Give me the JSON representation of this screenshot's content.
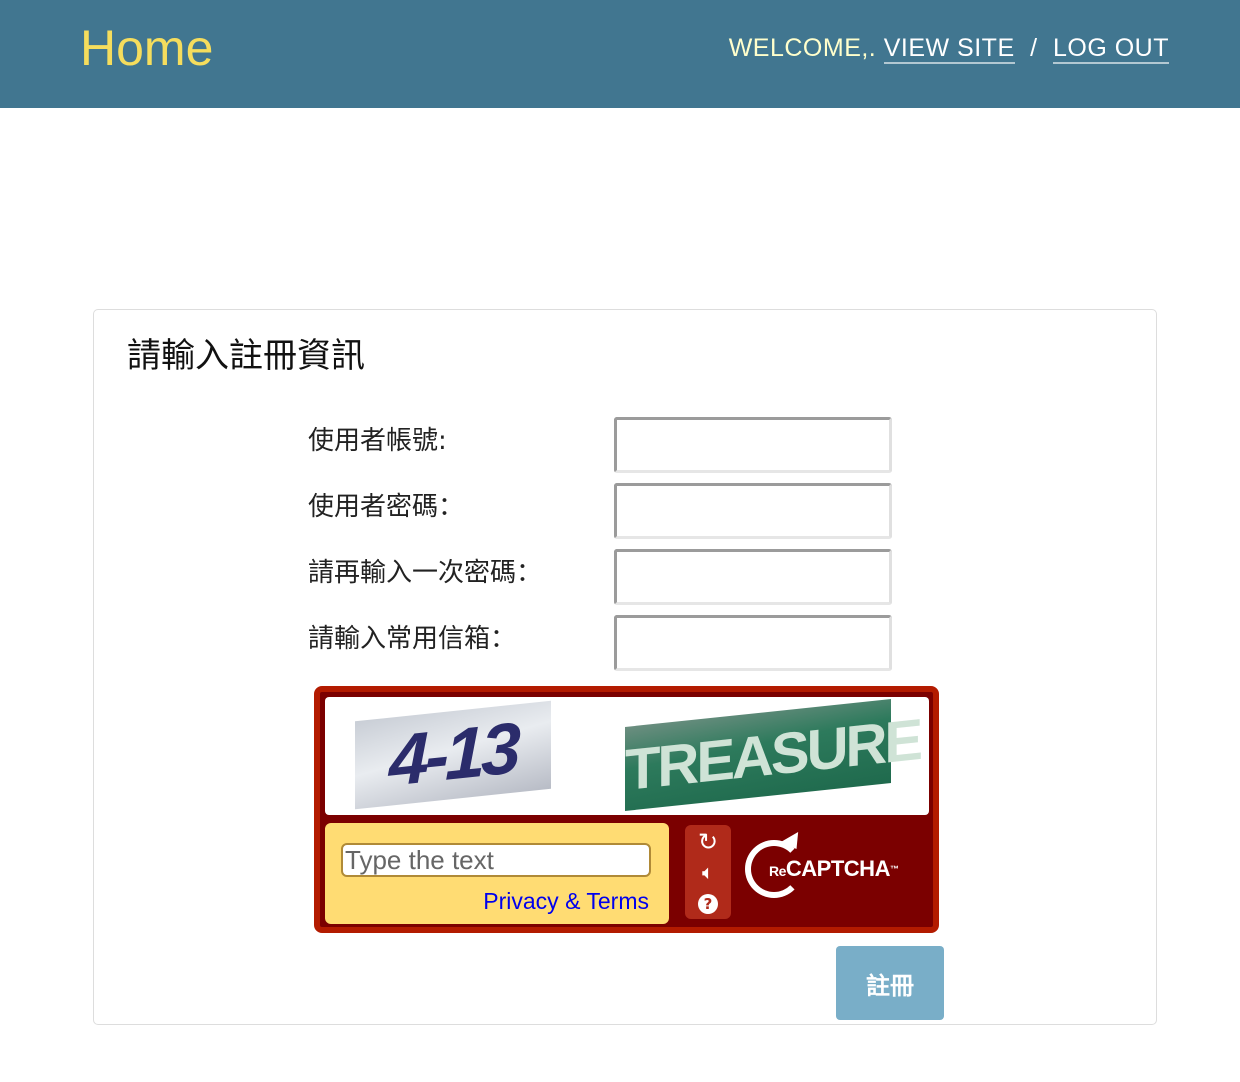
{
  "header": {
    "brand": "Home",
    "welcome_text": "WELCOME,.",
    "view_site": "VIEW SITE",
    "separator": "/",
    "log_out": "LOG OUT"
  },
  "form": {
    "title": "請輸入註冊資訊",
    "fields": [
      {
        "label": "使用者帳號:",
        "value": ""
      },
      {
        "label": "使用者密碼：",
        "value": ""
      },
      {
        "label": "請再輸入一次密碼：",
        "value": ""
      },
      {
        "label": "請輸入常用信箱：",
        "value": ""
      }
    ],
    "submit_label": "註冊"
  },
  "captcha": {
    "challenge_words": [
      "4-13",
      "TREASURE"
    ],
    "input_placeholder": "Type the text",
    "privacy_terms": "Privacy & Terms",
    "buttons": [
      "refresh-icon",
      "audio-icon",
      "help-icon"
    ],
    "logo_re": "Re",
    "logo_name": "CAPTCHA",
    "logo_tm": "™"
  },
  "colors": {
    "header_bg": "#417690",
    "brand": "#f5dd5d",
    "captcha_bg": "#7b0000",
    "captcha_input_bg": "#ffdc73",
    "submit_bg": "#79aec8"
  }
}
